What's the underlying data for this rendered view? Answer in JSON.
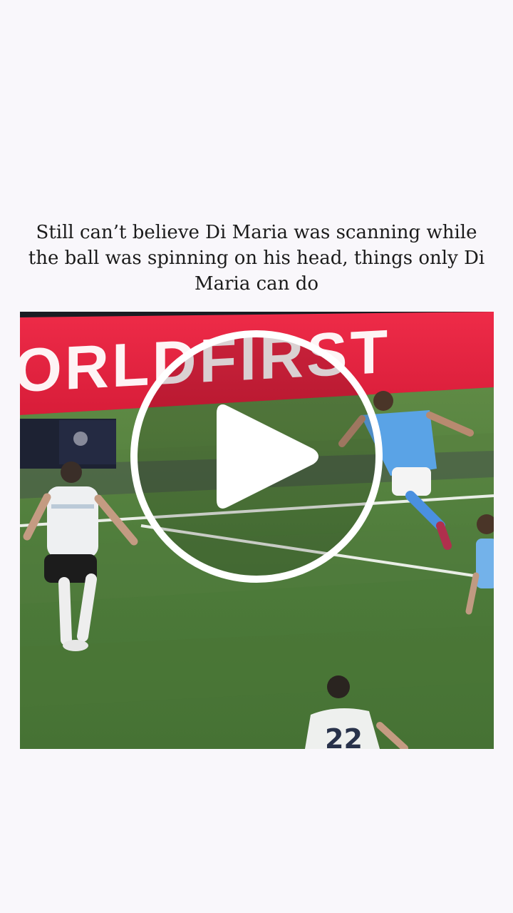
{
  "post": {
    "caption": "Still can’t believe Di Maria was scanning while the ball was spinning on his head, things only Di Maria can do"
  },
  "video": {
    "banner_text": "ORLDFIRST",
    "banner_color": "#e6223f",
    "pitch_color": "#4f7d3b",
    "player_number": "22",
    "play_icon": "play-icon"
  }
}
